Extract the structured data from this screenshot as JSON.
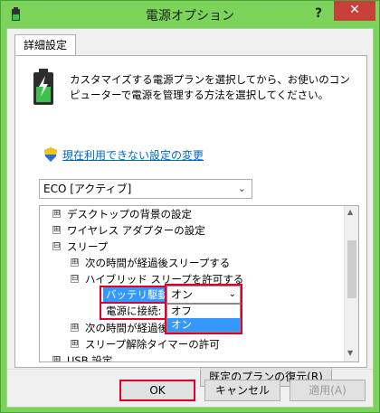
{
  "window": {
    "title": "電源オプション",
    "help": "?",
    "close": "✕"
  },
  "tab": {
    "label": "詳細設定"
  },
  "panel": {
    "description": "カスタマイズする電源プランを選択してから、お使いのコンピューターで電源を管理する方法を選択してください。",
    "change_link": "現在利用できない設定の変更",
    "plan_value": "ECO [アクティブ]",
    "restore_label": "既定のプランの復元(R)"
  },
  "tree": {
    "items": [
      {
        "expander": "⊞",
        "label": "デスクトップの背景の設定"
      },
      {
        "expander": "⊞",
        "label": "ワイヤレス アダプターの設定"
      },
      {
        "expander": "⊟",
        "label": "スリープ"
      },
      {
        "expander": "⊞",
        "label": "次の時間が経過後スリープする"
      },
      {
        "expander": "⊟",
        "label": "ハイブリッド スリープを許可する"
      },
      {
        "expander": "⊞",
        "label": "次の時間が経過後"
      },
      {
        "expander": "⊞",
        "label": "スリープ解除タイマーの許可"
      },
      {
        "expander": "⊞",
        "label": "USB 設定"
      }
    ],
    "battery_label": "バッテリ駆動:",
    "ac_label": "電源に接続:"
  },
  "dropdown": {
    "value": "オン",
    "options": [
      "オフ",
      "オン"
    ]
  },
  "buttons": {
    "ok": "OK",
    "cancel": "キャンセル",
    "apply": "適用(A)"
  },
  "colors": {
    "frame": "#7bd35a",
    "close": "#c7413a",
    "selection": "#3399ff",
    "highlight": "#e0002b",
    "link": "#0066cc"
  }
}
